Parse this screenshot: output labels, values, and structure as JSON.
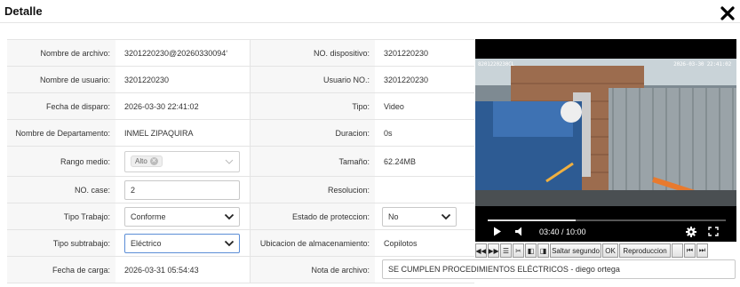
{
  "modal": {
    "title": "Detalle"
  },
  "fields": {
    "nombre_archivo": {
      "label": "Nombre de archivo:",
      "value": "3201220230@20260330094‘"
    },
    "no_dispositivo": {
      "label": "NO. dispositivo:",
      "value": "3201220230"
    },
    "nombre_usuario": {
      "label": "Nombre de usuario:",
      "value": "3201220230"
    },
    "usuario_no": {
      "label": "Usuario NO.:",
      "value": "3201220230"
    },
    "fecha_disparo": {
      "label": "Fecha de disparo:",
      "value": "2026-03-30 22:41:02"
    },
    "tipo": {
      "label": "Tipo:",
      "value": "Video"
    },
    "departamento": {
      "label": "Nombre de Departamento:",
      "value": "INMEL ZIPAQUIRA"
    },
    "duracion": {
      "label": "Duracion:",
      "value": "0s"
    },
    "rango_medio": {
      "label": "Rango medio:",
      "tag": "Alto"
    },
    "tamano": {
      "label": "Tamaño:",
      "value": "62.24MB"
    },
    "no_case": {
      "label": "NO. case:",
      "value": "2"
    },
    "resolucion": {
      "label": "Resolucion:",
      "value": ""
    },
    "tipo_trabajo": {
      "label": "Tipo Trabajo:",
      "value": "Conforme"
    },
    "estado_proteccion": {
      "label": "Estado de proteccion:",
      "value": "No"
    },
    "tipo_subtrabajo": {
      "label": "Tipo subtrabajo:",
      "value": "Eléctrico"
    },
    "ubicacion": {
      "label": "Ubicacion de almacenamiento:",
      "value": "Copilotos"
    },
    "fecha_carga": {
      "label": "Fecha de carga:",
      "value": "2026-03-31 05:54:43"
    },
    "nota_archivo": {
      "label": "Nota de archivo:",
      "value": "SE CUMPLEN PROCEDIMIENTOS ELÉCTRICOS - diego ortega"
    }
  },
  "video": {
    "osd_left": "8201220230CL",
    "osd_right": "2026-03-30 22:41:02",
    "time": "03:40 / 10:00",
    "progress": 0.37
  },
  "toolbar": {
    "skip": "Saltar segundo",
    "ok": "OK",
    "playback": "Reproduccion"
  },
  "icons": [
    "close-icon",
    "play-icon",
    "volume-icon",
    "settings-gear-icon",
    "fullscreen-icon",
    "chevron-down-icon"
  ]
}
